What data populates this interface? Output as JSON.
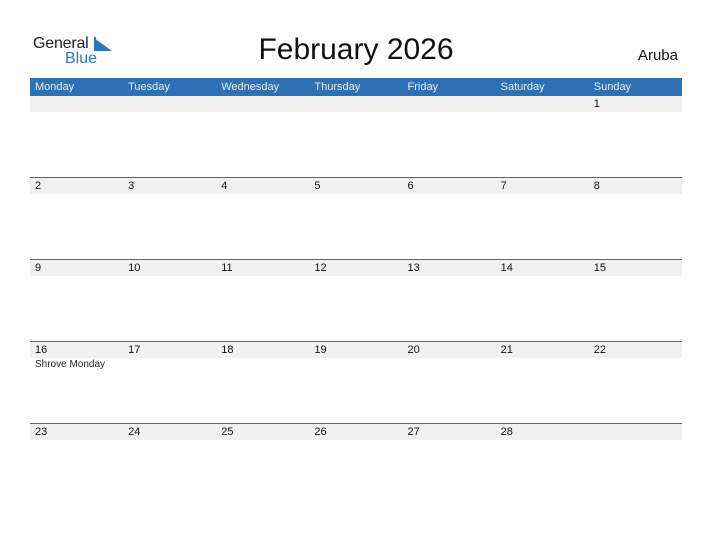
{
  "logo": {
    "line1": "General",
    "line2": "Blue"
  },
  "title": "February 2026",
  "country": "Aruba",
  "colors": {
    "header": "#2d70b3",
    "band": "#f1f1f1",
    "brand": "#2a78c2"
  },
  "weekdays": [
    "Monday",
    "Tuesday",
    "Wednesday",
    "Thursday",
    "Friday",
    "Saturday",
    "Sunday"
  ],
  "weeks": [
    [
      {
        "d": ""
      },
      {
        "d": ""
      },
      {
        "d": ""
      },
      {
        "d": ""
      },
      {
        "d": ""
      },
      {
        "d": ""
      },
      {
        "d": "1"
      }
    ],
    [
      {
        "d": "2"
      },
      {
        "d": "3"
      },
      {
        "d": "4"
      },
      {
        "d": "5"
      },
      {
        "d": "6"
      },
      {
        "d": "7"
      },
      {
        "d": "8"
      }
    ],
    [
      {
        "d": "9"
      },
      {
        "d": "10"
      },
      {
        "d": "11"
      },
      {
        "d": "12"
      },
      {
        "d": "13"
      },
      {
        "d": "14"
      },
      {
        "d": "15"
      }
    ],
    [
      {
        "d": "16",
        "e": "Shrove Monday"
      },
      {
        "d": "17"
      },
      {
        "d": "18"
      },
      {
        "d": "19"
      },
      {
        "d": "20"
      },
      {
        "d": "21"
      },
      {
        "d": "22"
      }
    ],
    [
      {
        "d": "23"
      },
      {
        "d": "24"
      },
      {
        "d": "25"
      },
      {
        "d": "26"
      },
      {
        "d": "27"
      },
      {
        "d": "28"
      },
      {
        "d": ""
      }
    ]
  ]
}
